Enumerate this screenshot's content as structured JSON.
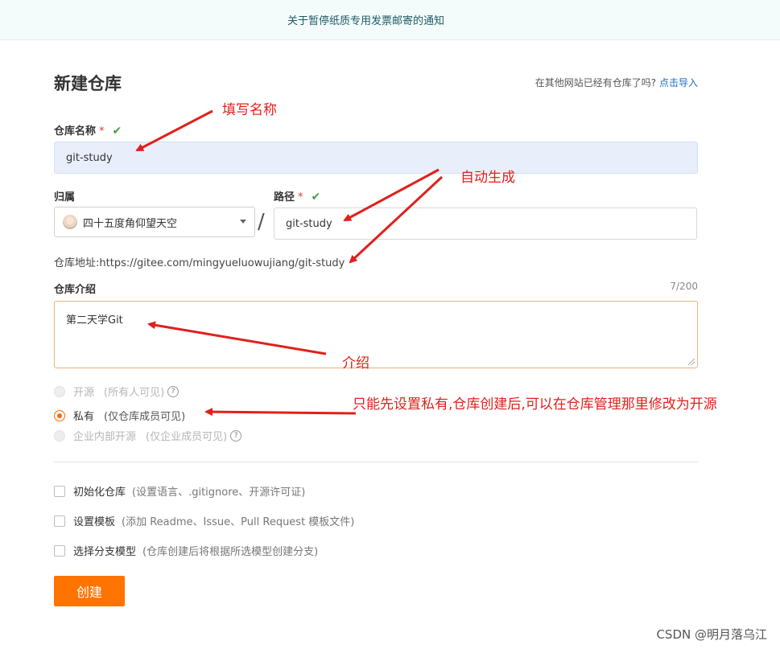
{
  "notice": {
    "text": "关于暂停纸质专用发票邮寄的通知"
  },
  "header": {
    "title": "新建仓库",
    "import_prompt": "在其他网站已经有仓库了吗?",
    "import_link": "点击导入"
  },
  "form": {
    "name_label": "仓库名称",
    "name_required": "*",
    "name_check": "✔",
    "name_value": "git-study",
    "owner_label": "归属",
    "owner_value": "四十五度角仰望天空",
    "separator": "/",
    "path_label": "路径",
    "path_required": "*",
    "path_check": "✔",
    "path_value": "git-study",
    "url_label": "仓库地址:",
    "url_value": "https://gitee.com/mingyueluowujiang/git-study",
    "intro_label": "仓库介绍",
    "intro_counter": "7/200",
    "intro_value": "第二天学Git"
  },
  "visibility": {
    "options": [
      {
        "label": "开源",
        "hint": "(所有人可见)",
        "help": "?"
      },
      {
        "label": "私有",
        "hint": "(仅仓库成员可见)"
      },
      {
        "label": "企业内部开源",
        "hint": "(仅企业成员可见)",
        "help": "?"
      }
    ],
    "selected": "私有"
  },
  "options": {
    "init": {
      "label": "初始化仓库",
      "hint": "(设置语言、.gitignore、开源许可证)"
    },
    "template": {
      "label": "设置模板",
      "hint": "(添加 Readme、Issue、Pull Request 模板文件)"
    },
    "branch": {
      "label": "选择分支模型",
      "hint": "(仓库创建后将根据所选模型创建分支)"
    }
  },
  "create_button": "创建",
  "annotations": {
    "fill_name": "填写名称",
    "auto_generate": "自动生成",
    "intro": "介绍",
    "private_note": "只能先设置私有,仓库创建后,可以在仓库管理那里修改为开源"
  },
  "watermark": "CSDN @明月落乌江",
  "colors": {
    "accent": "#ff7300",
    "annotation": "#e0201b",
    "link": "#1a6fc2",
    "success": "#43a047"
  }
}
